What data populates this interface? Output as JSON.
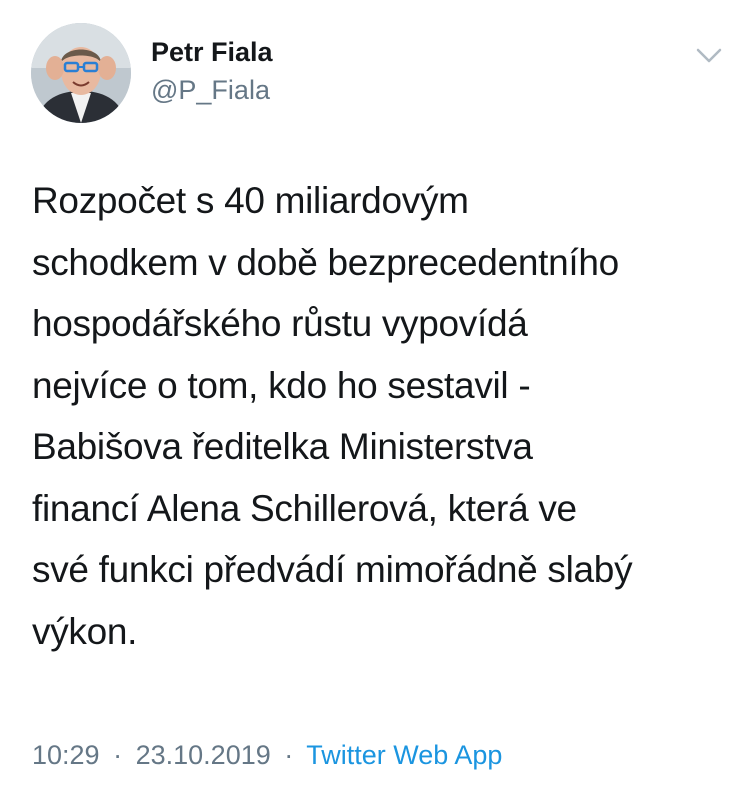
{
  "tweet": {
    "author": {
      "display_name": "Petr Fiala",
      "handle": "@P_Fiala",
      "avatar": "profile-photo"
    },
    "menu_icon": "chevron-down-icon",
    "text": "Rozpočet s 40 miliardovým\nschodkem v době bezprecedentního\nhospodářského růstu vypovídá\nnejvíce o tom, kdo ho sestavil -\nBabišova ředitelka Ministerstva\nfinancí Alena Schillerová, která ve\nsvé funkci předvádí mimořádně slabý\nvýkon.",
    "time": "10:29",
    "separator": "·",
    "date": "23.10.2019",
    "source": "Twitter Web App"
  },
  "colors": {
    "text": "#14171a",
    "secondary": "#657786",
    "link": "#1b95e0",
    "background": "#ffffff"
  }
}
